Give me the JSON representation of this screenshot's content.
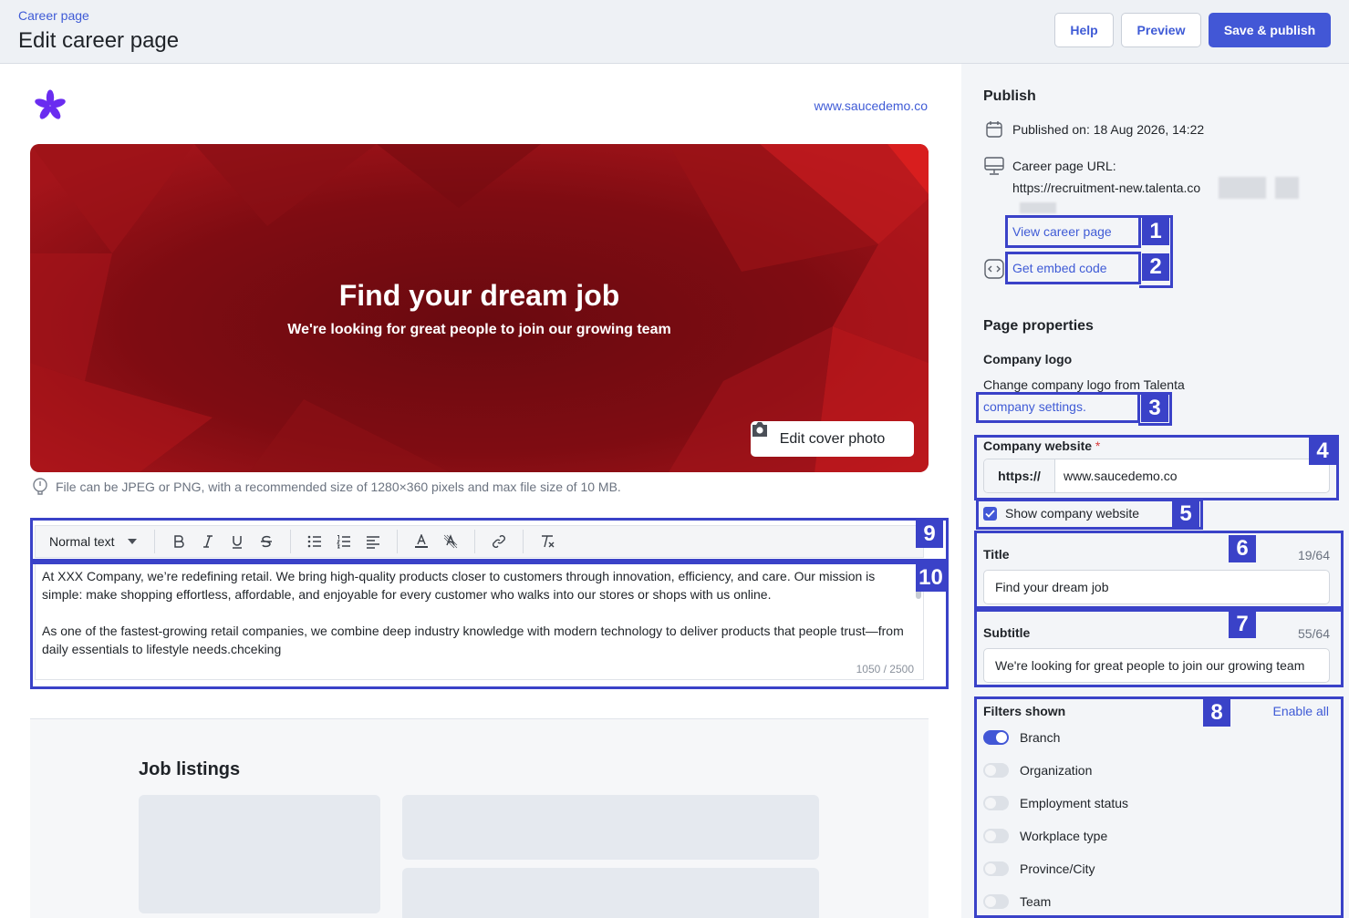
{
  "header": {
    "breadcrumb": "Career page",
    "title": "Edit career page",
    "help_label": "Help",
    "preview_label": "Preview",
    "publish_label": "Save & publish"
  },
  "preview": {
    "website_link": "www.saucedemo.co",
    "cover_title": "Find your dream job",
    "cover_subtitle": "We're looking for great people to join our growing team",
    "edit_cover_label": "Edit cover photo",
    "file_hint": "File can be JPEG or PNG, with a recommended size of 1280×360 pixels and max file size of 10 MB.",
    "editor": {
      "format_value": "Normal text",
      "paragraph_1": "At XXX Company, we’re redefining retail. We bring high-quality products closer to customers through innovation, efficiency, and care. Our mission is simple: make shopping effortless, affordable, and enjoyable for every customer who walks into our stores or shops with us online.",
      "paragraph_2": "As one of the fastest-growing retail companies, we combine deep industry knowledge with modern technology to deliver products that people trust—from daily essentials to lifestyle needs.chceking",
      "counter": "1050 / 2500"
    },
    "job_listings_title": "Job listings"
  },
  "publish": {
    "heading": "Publish",
    "published_on": "Published on: 18 Aug 2026, 14:22",
    "url_label": "Career page URL:",
    "url_value": "https://recruitment-new.talenta.co",
    "view_link": "View career page",
    "embed_link": "Get embed code"
  },
  "properties": {
    "heading": "Page properties",
    "logo_label": "Company logo",
    "logo_hint": "Change company logo from Talenta",
    "settings_link": "company settings.",
    "website_label": "Company website",
    "required_mark": "*",
    "website_prefix": "https://",
    "website_value": "www.saucedemo.co",
    "show_website_label": "Show company website",
    "title_label": "Title",
    "title_count": "19/64",
    "title_value": "Find your dream job",
    "subtitle_label": "Subtitle",
    "subtitle_count": "55/64",
    "subtitle_value": "We're looking for great people to join our growing team",
    "filters_label": "Filters shown",
    "enable_all": "Enable all",
    "filters": [
      {
        "label": "Branch",
        "enabled": true
      },
      {
        "label": "Organization",
        "enabled": false
      },
      {
        "label": "Employment status",
        "enabled": false
      },
      {
        "label": "Workplace type",
        "enabled": false
      },
      {
        "label": "Province/City",
        "enabled": false
      },
      {
        "label": "Team",
        "enabled": false
      }
    ]
  },
  "annotations": [
    "1",
    "2",
    "3",
    "4",
    "5",
    "6",
    "7",
    "8",
    "9",
    "10"
  ],
  "colors": {
    "accent": "#4257d6",
    "annotation": "#3a42c8",
    "cover": "#8c0e12"
  }
}
